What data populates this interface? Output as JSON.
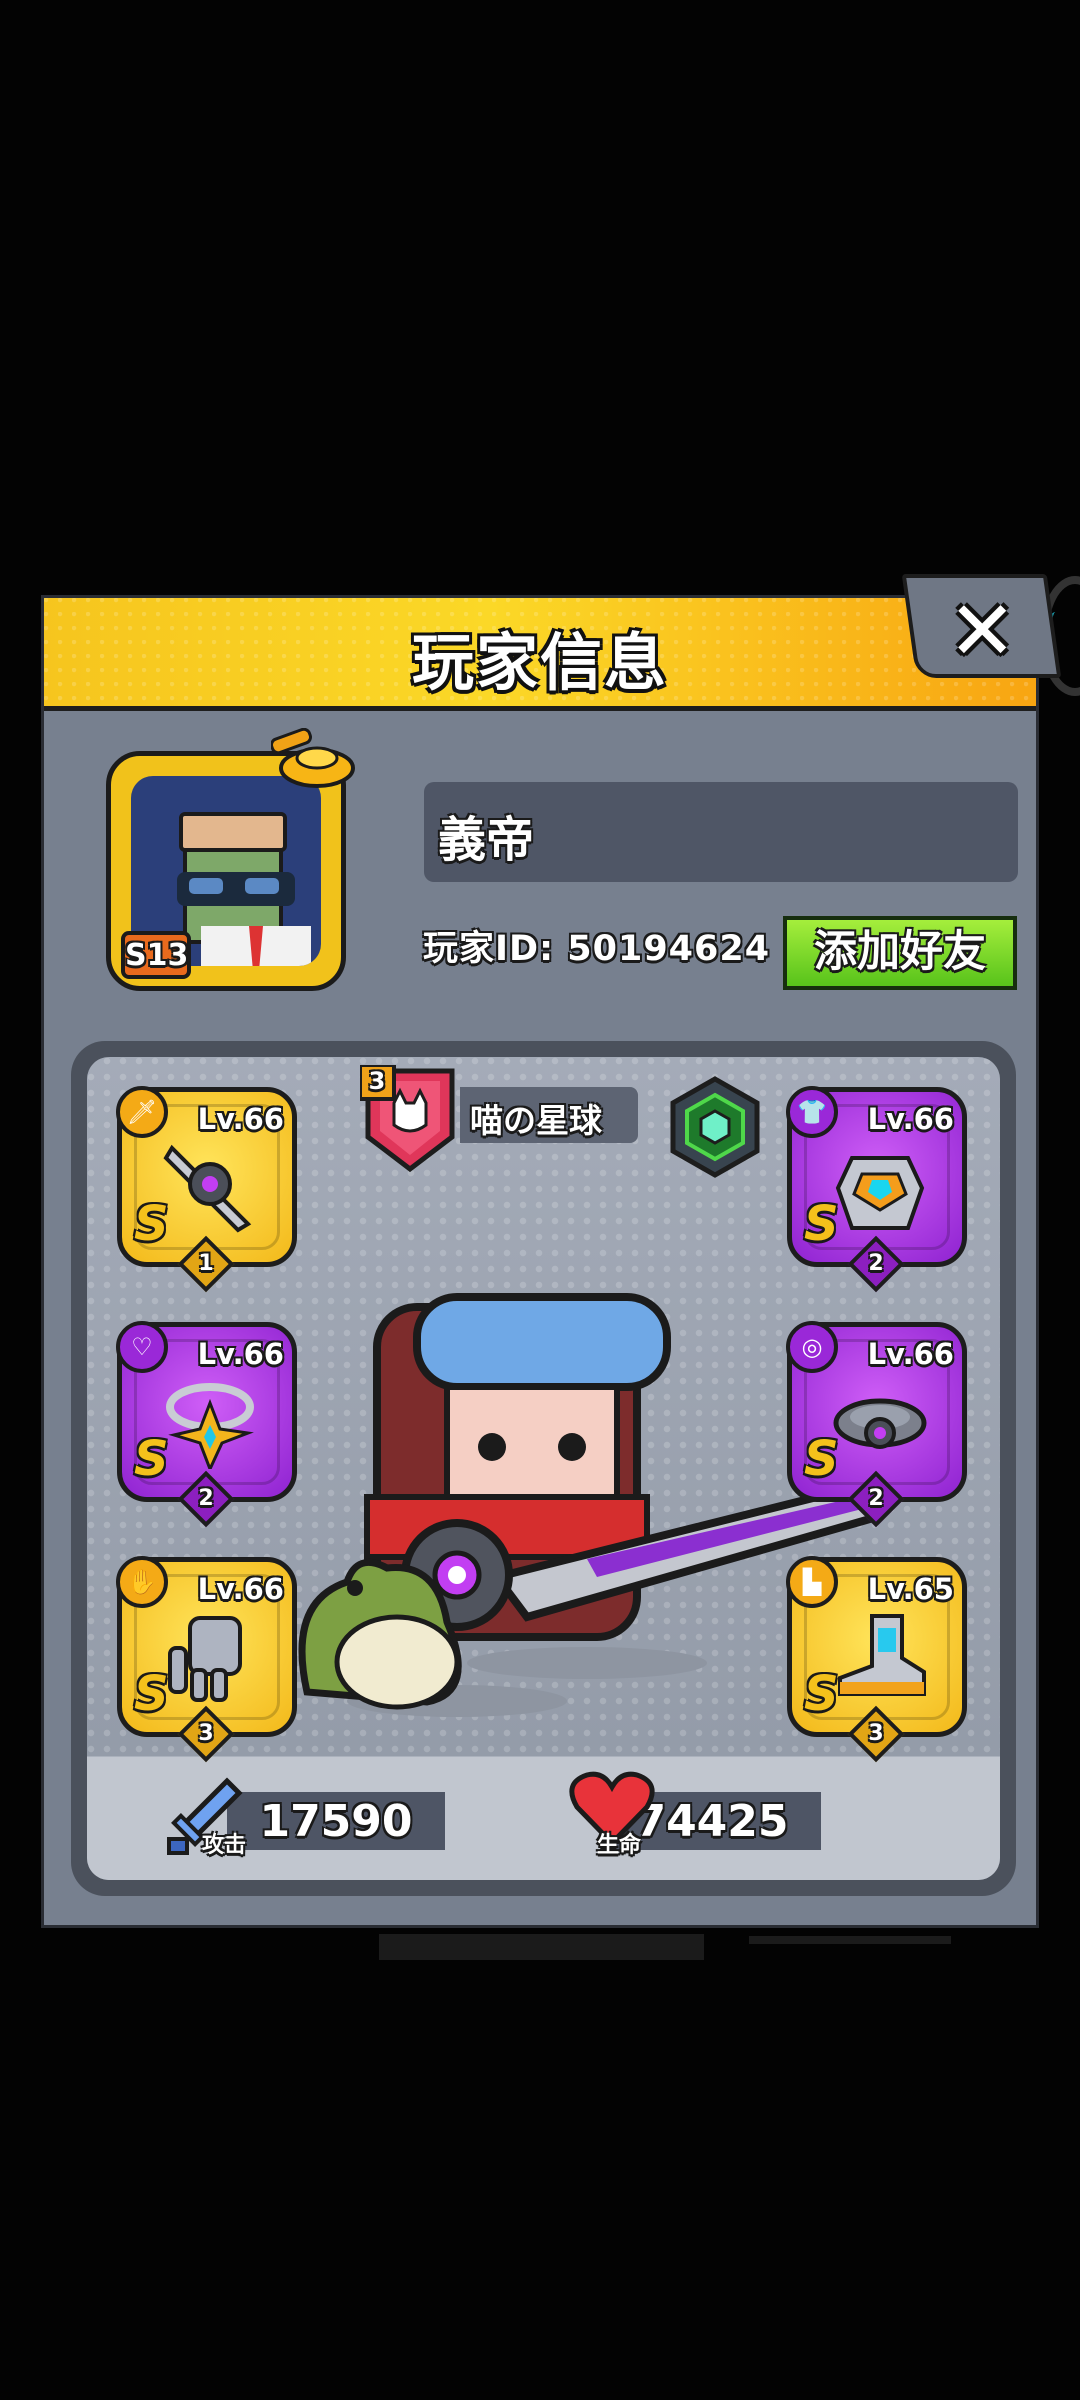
{
  "header": {
    "title": "玩家信息",
    "close_icon": "close-icon"
  },
  "player": {
    "name": "義帝",
    "id_text": "玩家ID: 50194624",
    "season_badge": "S13",
    "add_friend_label": "添加好友"
  },
  "guild": {
    "level": "3",
    "name": "喵の星球"
  },
  "equipment": {
    "left": [
      {
        "type": "weapon",
        "icon": "sword-icon",
        "level": "Lv.66",
        "grade": "S",
        "stars": "1",
        "rarity": "gold"
      },
      {
        "type": "necklace",
        "icon": "necklace-icon",
        "level": "Lv.66",
        "grade": "S",
        "stars": "2",
        "rarity": "purple"
      },
      {
        "type": "gloves",
        "icon": "glove-icon",
        "level": "Lv.66",
        "grade": "S",
        "stars": "3",
        "rarity": "gold"
      }
    ],
    "right": [
      {
        "type": "armor",
        "icon": "shirt-icon",
        "level": "Lv.66",
        "grade": "S",
        "stars": "2",
        "rarity": "purple"
      },
      {
        "type": "belt",
        "icon": "belt-icon",
        "level": "Lv.66",
        "grade": "S",
        "stars": "2",
        "rarity": "purple"
      },
      {
        "type": "boots",
        "icon": "boot-icon",
        "level": "Lv.65",
        "grade": "S",
        "stars": "3",
        "rarity": "gold"
      }
    ]
  },
  "stats": {
    "attack_label": "攻击",
    "attack_value": "17590",
    "hp_label": "生命",
    "hp_value": "74425"
  },
  "colors": {
    "header_yellow": "#f9cf22",
    "modal_bg": "#77808f",
    "friend_green": "#7ed82a",
    "gold_slot": "#f3b91a",
    "purple_slot": "#9b2fdc"
  }
}
